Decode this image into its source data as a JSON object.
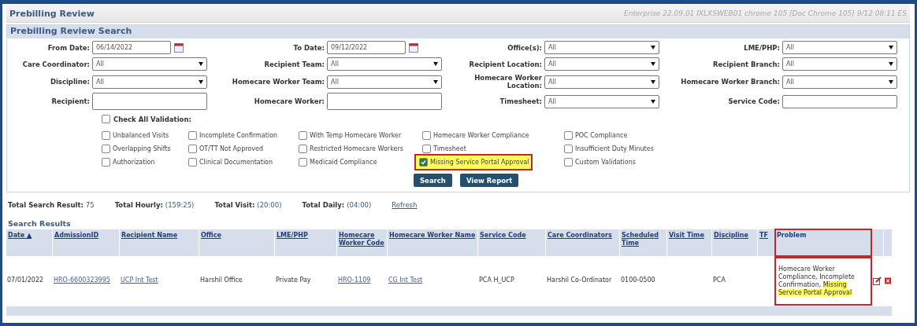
{
  "window": {
    "title": "Prebilling Review",
    "version": "Enterprise 22.09.01 IXLXSWEB01 chrome 105 [Doc Chrome 105] 9/12 08:11 ES"
  },
  "search_panel": {
    "title": "Prebilling Review Search",
    "fields": [
      {
        "kind": "date",
        "label": "From Date:",
        "value": "06/14/2022"
      },
      {
        "kind": "date",
        "label": "To Date:",
        "value": "09/12/2022"
      },
      {
        "kind": "select",
        "label": "Office(s):",
        "value": "All"
      },
      {
        "kind": "select",
        "label": "LME/PHP:",
        "value": "All"
      },
      {
        "kind": "select",
        "label": "Care Coordinator:",
        "value": "All"
      },
      {
        "kind": "select",
        "label": "Recipient Team:",
        "value": "All"
      },
      {
        "kind": "select",
        "label": "Recipient Location:",
        "value": "All"
      },
      {
        "kind": "select",
        "label": "Recipient Branch:",
        "value": "All"
      },
      {
        "kind": "select",
        "label": "Discipline:",
        "value": "All"
      },
      {
        "kind": "select",
        "label": "Homecare Worker Team:",
        "value": "All"
      },
      {
        "kind": "select",
        "label": "Homecare Worker Location:",
        "value": "All"
      },
      {
        "kind": "select",
        "label": "Homecare Worker Branch:",
        "value": "All"
      },
      {
        "kind": "text",
        "label": "Recipient:"
      },
      {
        "kind": "text",
        "label": "Homecare Worker:"
      },
      {
        "kind": "select",
        "label": "Timesheet:",
        "value": "All"
      },
      {
        "kind": "text",
        "label": "Service Code:"
      }
    ],
    "check_all": {
      "label": "Check All Validation:",
      "checked": false
    },
    "validations": [
      {
        "label": "Unbalanced Visits",
        "checked": false,
        "highlighted": false
      },
      {
        "label": "Incomplete Confirmation",
        "checked": false,
        "highlighted": false
      },
      {
        "label": "With Temp Homecare Worker",
        "checked": false,
        "highlighted": false
      },
      {
        "label": "Homecare Worker Compliance",
        "checked": false,
        "highlighted": false
      },
      {
        "label": "POC Compliance",
        "checked": false,
        "highlighted": false
      },
      {
        "label": "Overlapping Shifts",
        "checked": false,
        "highlighted": false
      },
      {
        "label": "OT/TT Not Approved",
        "checked": false,
        "highlighted": false
      },
      {
        "label": "Restricted Homecare Workers",
        "checked": false,
        "highlighted": false
      },
      {
        "label": "Timesheet",
        "checked": false,
        "highlighted": false
      },
      {
        "label": "Insufficient Duty Minutes",
        "checked": false,
        "highlighted": false
      },
      {
        "label": "Authorization",
        "checked": false,
        "highlighted": false
      },
      {
        "label": "Clinical Documentation",
        "checked": false,
        "highlighted": false
      },
      {
        "label": "Medicaid Compliance",
        "checked": false,
        "highlighted": false
      },
      {
        "label": "Missing Service Portal Approval",
        "checked": true,
        "highlighted": true
      },
      {
        "label": "Custom Validations",
        "checked": false,
        "highlighted": false
      }
    ],
    "buttons": [
      "Search",
      "View Report"
    ]
  },
  "totals": [
    {
      "label": "Total Search Result:",
      "value": "75"
    },
    {
      "label": "Total Hourly:",
      "value": "(159:25)"
    },
    {
      "label": "Total Visit:",
      "value": "(20:00)"
    },
    {
      "label": "Total Daily:",
      "value": "(04:00)"
    }
  ],
  "refresh_link": "Refresh",
  "results": {
    "title": "Search Results",
    "columns": [
      {
        "label": "Date ▲",
        "link": true
      },
      {
        "label": "AdmissionID",
        "link": true
      },
      {
        "label": "Recipient Name",
        "link": true
      },
      {
        "label": "Office",
        "link": true
      },
      {
        "label": "LME/PHP",
        "link": true
      },
      {
        "label": "Homecare Worker Code",
        "link": true
      },
      {
        "label": "Homecare Worker Name",
        "link": true
      },
      {
        "label": "Service Code",
        "link": true
      },
      {
        "label": "Care Coordinators",
        "link": true
      },
      {
        "label": "Scheduled Time",
        "link": true
      },
      {
        "label": "Visit Time",
        "link": true
      },
      {
        "label": "Discipline",
        "link": true
      },
      {
        "label": "TF",
        "link": true
      },
      {
        "label": "Problem",
        "link": false,
        "highlighted": true
      }
    ],
    "rows": [
      {
        "cells": [
          {
            "text": "07/01/2022",
            "link": false
          },
          {
            "text": "HRO-6600323995",
            "link": true
          },
          {
            "text": "UCP Int Test",
            "link": true
          },
          {
            "text": "Harshil Office",
            "link": false
          },
          {
            "text": "Private Pay",
            "link": false
          },
          {
            "text": "HRO-1109",
            "link": true
          },
          {
            "text": "CG Int Test",
            "link": true
          },
          {
            "text": "PCA H_UCP",
            "link": false
          },
          {
            "text": "Harshil Co-Ordinator",
            "link": false
          },
          {
            "text": "0100-0500",
            "link": false
          },
          {
            "text": ""
          },
          {
            "text": "PCA",
            "link": false
          },
          {
            "text": ""
          }
        ],
        "problem": {
          "text": "Homecare Worker Compliance, Incomplete Confirmation, ",
          "highlight": "Missing Service Portal Approval"
        }
      }
    ]
  }
}
